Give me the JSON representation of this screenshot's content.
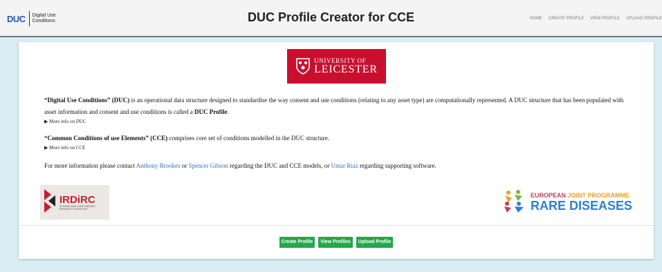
{
  "header": {
    "logo_mark": "DUC",
    "logo_text": "Digital Use Conditions",
    "title": "DUC Profile Creator for CCE",
    "nav": [
      "HOME",
      "CREATE PROFILE",
      "VIEW PROFILE",
      "UPLOAD PROFILE"
    ]
  },
  "university_logo": {
    "line1": "UNIVERSITY OF",
    "line2": "LEICESTER"
  },
  "intro": {
    "duc_term": "“Digital Use Conditions” (DUC)",
    "duc_text": " is an operational data structure designed to standardise the way consent and use conditions (relating to any asset type) are computationally represented. A DUC structure that has been populated with asset information and consent and use conditions is called a ",
    "duc_profile": "DUC Profile",
    "duc_end": ".",
    "more_duc": "▶  More info on DUC",
    "cce_term": "“Common Conditions of use Elements” (CCE)",
    "cce_text": " comprises core set of conditions modelled in the DUC structure.",
    "more_cce": "▶  More info on CCE",
    "contact_pre": "For more information please contact ",
    "contact_1": "Anthony Brookes",
    "contact_or": " or ",
    "contact_2": "Spencer Gibson",
    "contact_mid": " regarding the DUC and CCE models, or ",
    "contact_3": "Umar Riaz",
    "contact_end": " regarding supporting software."
  },
  "partners": {
    "irdirc_name": "IRDiRC",
    "irdirc_sub": "INTERNATIONAL RARE DISEASES RESEARCH CONSORTIUM",
    "ejp_top_a": "EUROPEAN",
    "ejp_top_b": " JOINT PROGRAMME",
    "ejp_bottom": "RARE DISEASES"
  },
  "actions": {
    "create": "Create Profile",
    "view": "View Profiles",
    "upload": "Upload Profile"
  },
  "colors": {
    "background": "#d9eef4",
    "header_bg": "#f4f4f4",
    "button_green": "#22a84a",
    "link_blue": "#2f6fcf",
    "leicester_red": "#c8102e"
  }
}
